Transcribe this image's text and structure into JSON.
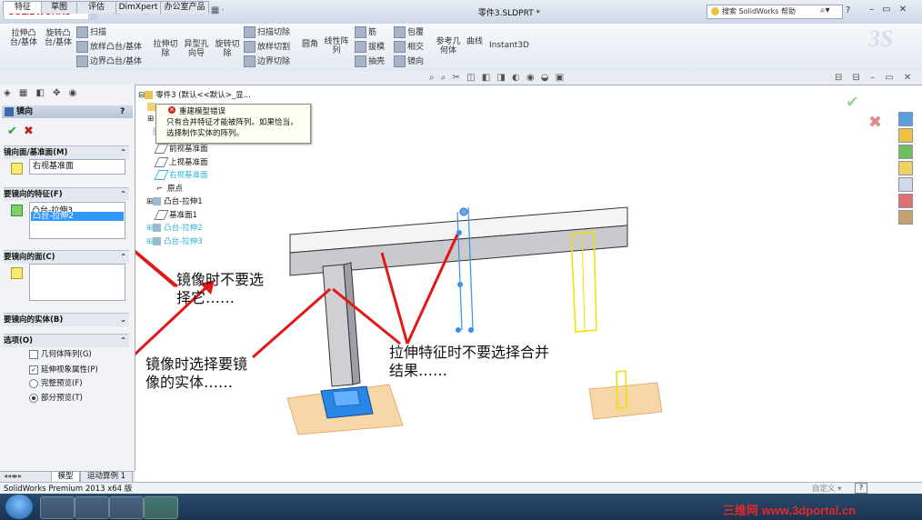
{
  "app": {
    "logo": "SOLIDWORKS",
    "doc_title": "零件3.SLDPRT *",
    "search_placeholder": "搜索 SolidWorks 帮助",
    "help": "?",
    "quick_icons": "□·◇·▣·◉·↶·↖·▯·▦·",
    "window_ctrl": "– ▭ ✕"
  },
  "ribbon": {
    "boss_extrude": "拉伸凸\n台/基体",
    "revolve_boss": "旋转凸\n台/基体",
    "sweep": "扫描",
    "loft": "放样凸台/基体",
    "boundary_boss": "边界凸台/基体",
    "extrude_cut": "拉伸切\n除",
    "hole_wizard": "异型孔\n向导",
    "revolve_cut": "旋转切\n除",
    "swept_cut": "扫描切除",
    "lofted_cut": "放样切割",
    "boundary_cut": "边界切除",
    "fillet": "圆角",
    "linear_pattern": "线性阵\n列",
    "rib": "筋",
    "draft": "拔模",
    "shell": "抽壳",
    "wrap": "包覆",
    "intersect": "相交",
    "mirror": "镜向",
    "ref_geometry": "参考几\n何体",
    "curves": "曲线",
    "instant3d": "Instant3D"
  },
  "tabs": [
    "特征",
    "草图",
    "评估",
    "DimXpert",
    "办公室产品"
  ],
  "view_tools": "⌕ ⌕ ✂ ◫ ◧ ◨ ◐ ◉ ◒ ▣",
  "view_ctrl": "⊟ ⊟ – ▭ ✕",
  "panel_icons": "◈ ▦ ◧ ✥ ◉",
  "property_manager": {
    "title": "镜向",
    "help": "?",
    "mirror_face_label": "镜向面/基准面(M)",
    "mirror_face_value": "右视基准面",
    "features_label": "要镜向的特征(F)",
    "features": [
      "凸台-拉伸3",
      "凸台-拉伸2"
    ],
    "faces_label": "要镜向的面(C)",
    "bodies_label": "要镜向的实体(B)",
    "options_label": "选项(O)",
    "opt_geometry_pattern": "几何体阵列(G)",
    "opt_propagate": "延伸视象属性(P)",
    "opt_full_preview": "完整预览(F)",
    "opt_partial_preview": "部分预览(T)",
    "section_chevrons": [
      "⌃",
      "⌃",
      "⌃",
      "⌄",
      "⌃"
    ]
  },
  "tree": {
    "root": "零件3 (默认<<默认>_显...",
    "items": [
      "前视基准面",
      "上视基准面",
      "右视基准面",
      "原点",
      "凸台-拉伸1",
      "基准面1",
      "凸台-拉伸2",
      "凸台-拉伸3"
    ],
    "prefix_plus": "⊞",
    "prefix_dash": "⊟"
  },
  "error_popup": {
    "title": "重建模型错误",
    "body": "只有合并特征才能被阵列。如果恰当，选择制作实体的阵列。"
  },
  "annotations": {
    "a1": "镜像时不要选\n择它……",
    "a2": "镜像时选择要镜\n像的实体……",
    "a3": "拉伸特征时不要选择合并\n结果……"
  },
  "bottom_tabs": [
    "模型",
    "运动算例 1"
  ],
  "status": {
    "text": "SolidWorks Premium 2013 x64 版",
    "right": "自定义 ▾"
  },
  "site": "三维网 www.3dportal.cn",
  "colors": {
    "accent": "#3399ff",
    "error": "#d02020",
    "ok": "#2a9d2a",
    "arrow": "#e01818",
    "highlight": "#2bb3d9",
    "yellow_preview": "#f0e000",
    "blue_body": "#1f7fe0"
  }
}
